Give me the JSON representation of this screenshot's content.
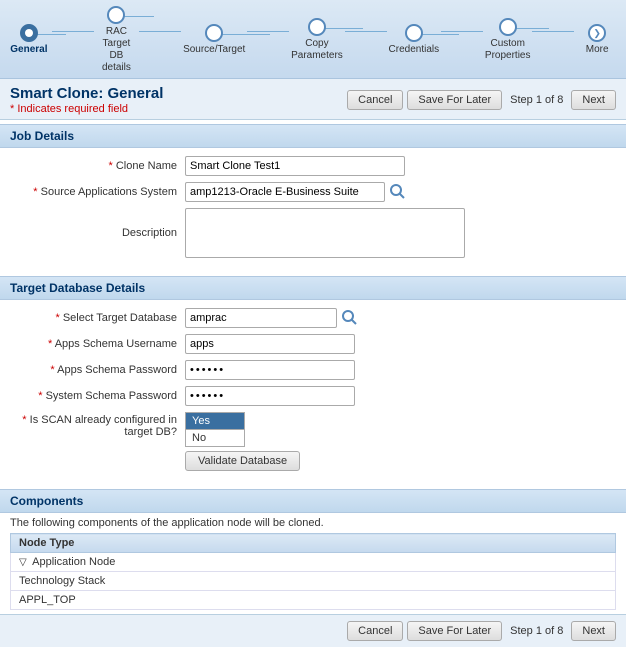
{
  "wizard": {
    "steps": [
      {
        "id": "general",
        "label": "General",
        "active": true
      },
      {
        "id": "rac-target",
        "label": "RAC Target\nDB details",
        "active": false
      },
      {
        "id": "source-target",
        "label": "Source/Target",
        "active": false
      },
      {
        "id": "copy-parameters",
        "label": "Copy\nParameters",
        "active": false
      },
      {
        "id": "credentials",
        "label": "Credentials",
        "active": false
      },
      {
        "id": "custom-properties",
        "label": "Custom\nProperties",
        "active": false
      }
    ],
    "more_label": "More",
    "next_label": "Next"
  },
  "page": {
    "title": "Smart Clone: General",
    "required_note": "* Indicates required field",
    "cancel_label": "Cancel",
    "save_label": "Save For Later",
    "step_info": "Step 1 of 8",
    "next_label": "Next"
  },
  "job_details": {
    "section_title": "Job Details",
    "clone_name_label": "* Clone Name",
    "clone_name_value": "Smart Clone Test1",
    "source_app_label": "* Source Applications System",
    "source_app_value": "amp1213-Oracle E-Business Suite",
    "description_label": "Description",
    "description_value": ""
  },
  "target_db": {
    "section_title": "Target Database Details",
    "select_db_label": "* Select Target Database",
    "select_db_value": "amprac",
    "apps_schema_user_label": "* Apps Schema Username",
    "apps_schema_user_value": "apps",
    "apps_schema_pwd_label": "* Apps Schema Password",
    "apps_schema_pwd_value": "••••••",
    "system_schema_pwd_label": "* System Schema Password",
    "system_schema_pwd_value": "••••••",
    "scan_label": "* Is SCAN already configured in target DB?",
    "scan_yes": "Yes",
    "scan_no": "No",
    "validate_btn_label": "Validate Database"
  },
  "components": {
    "section_title": "Components",
    "description": "The following components of the application node will be cloned.",
    "column_header": "Node Type",
    "rows": [
      {
        "label": "Application Node",
        "indent": 1,
        "toggle": "▽"
      },
      {
        "label": "Technology Stack",
        "indent": 2,
        "toggle": ""
      },
      {
        "label": "APPL_TOP",
        "indent": 2,
        "toggle": ""
      }
    ]
  },
  "bottom_bar": {
    "cancel_label": "Cancel",
    "save_label": "Save For Later",
    "step_info": "Step 1 of 8",
    "next_label": "Next"
  }
}
